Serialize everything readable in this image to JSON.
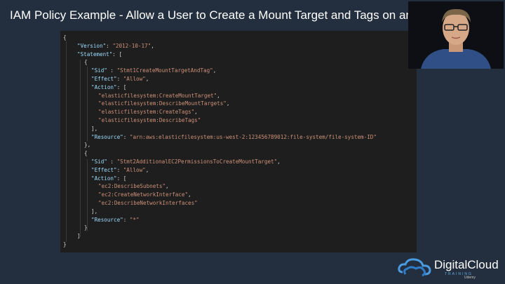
{
  "slide": {
    "title": "IAM Policy Example - Allow a User to Create a Mount Target and Tags on an Exi"
  },
  "code_lines": [
    [
      [
        "{",
        "p"
      ]
    ],
    [
      [
        "\"Version\"",
        "k"
      ],
      [
        ": ",
        "p"
      ],
      [
        "\"2012-10-17\"",
        "s"
      ],
      [
        ",",
        "p"
      ]
    ],
    [
      [
        "\"Statement\"",
        "k"
      ],
      [
        ": [",
        "p"
      ]
    ],
    [
      [
        "{",
        "p"
      ]
    ],
    [
      [
        "\"Sid\"",
        "k"
      ],
      [
        " : ",
        "p"
      ],
      [
        "\"Stmt1CreateMountTargetAndTag\"",
        "s"
      ],
      [
        ",",
        "p"
      ]
    ],
    [
      [
        "\"Effect\"",
        "k"
      ],
      [
        ": ",
        "p"
      ],
      [
        "\"Allow\"",
        "s"
      ],
      [
        ",",
        "p"
      ]
    ],
    [
      [
        "\"Action\"",
        "k"
      ],
      [
        ": [",
        "p"
      ]
    ],
    [
      [
        "\"elasticfilesystem:CreateMountTarget\"",
        "s"
      ],
      [
        ",",
        "p"
      ]
    ],
    [
      [
        "\"elasticfilesystem:DescribeMountTargets\"",
        "s"
      ],
      [
        ",",
        "p"
      ]
    ],
    [
      [
        "\"elasticfilesystem:CreateTags\"",
        "s"
      ],
      [
        ",",
        "p"
      ]
    ],
    [
      [
        "\"elasticfilesystem:DescribeTags\"",
        "s"
      ]
    ],
    [
      [
        "],",
        "p"
      ]
    ],
    [
      [
        "\"Resource\"",
        "k"
      ],
      [
        ": ",
        "p"
      ],
      [
        "\"arn:aws:elasticfilesystem:us-west-2:123456789012:file-system/file-system-ID\"",
        "s"
      ]
    ],
    [
      [
        "},",
        "p"
      ]
    ],
    [
      [
        "{",
        "p"
      ]
    ],
    [
      [
        "\"Sid\"",
        "k"
      ],
      [
        " : ",
        "p"
      ],
      [
        "\"Stmt2AdditionalEC2PermissionsToCreateMountTarget\"",
        "s"
      ],
      [
        ",",
        "p"
      ]
    ],
    [
      [
        "\"Effect\"",
        "k"
      ],
      [
        ": ",
        "p"
      ],
      [
        "\"Allow\"",
        "s"
      ],
      [
        ",",
        "p"
      ]
    ],
    [
      [
        "\"Action\"",
        "k"
      ],
      [
        ": [",
        "p"
      ]
    ],
    [
      [
        "\"ec2:DescribeSubnets\"",
        "s"
      ],
      [
        ",",
        "p"
      ]
    ],
    [
      [
        "\"ec2:CreateNetworkInterface\"",
        "s"
      ],
      [
        ",",
        "p"
      ]
    ],
    [
      [
        "\"ec2:DescribeNetworkInterfaces\"",
        "s"
      ]
    ],
    [
      [
        "],",
        "p"
      ]
    ],
    [
      [
        "\"Resource\"",
        "k"
      ],
      [
        ": ",
        "p"
      ],
      [
        "\"*\"",
        "s"
      ]
    ],
    [
      [
        "}",
        "p"
      ]
    ],
    [
      [
        "]",
        "p"
      ]
    ],
    [
      [
        "}",
        "p"
      ]
    ]
  ],
  "colors": {
    "background": "#232f3e",
    "editor_background": "#1e1e1e",
    "json_key": "#9cdcfe",
    "json_string": "#ce9178",
    "punctuation": "#d4d4d4"
  },
  "branding": {
    "name": "DigitalCloud",
    "sub": "TRAINING",
    "platform": "Udemy"
  }
}
